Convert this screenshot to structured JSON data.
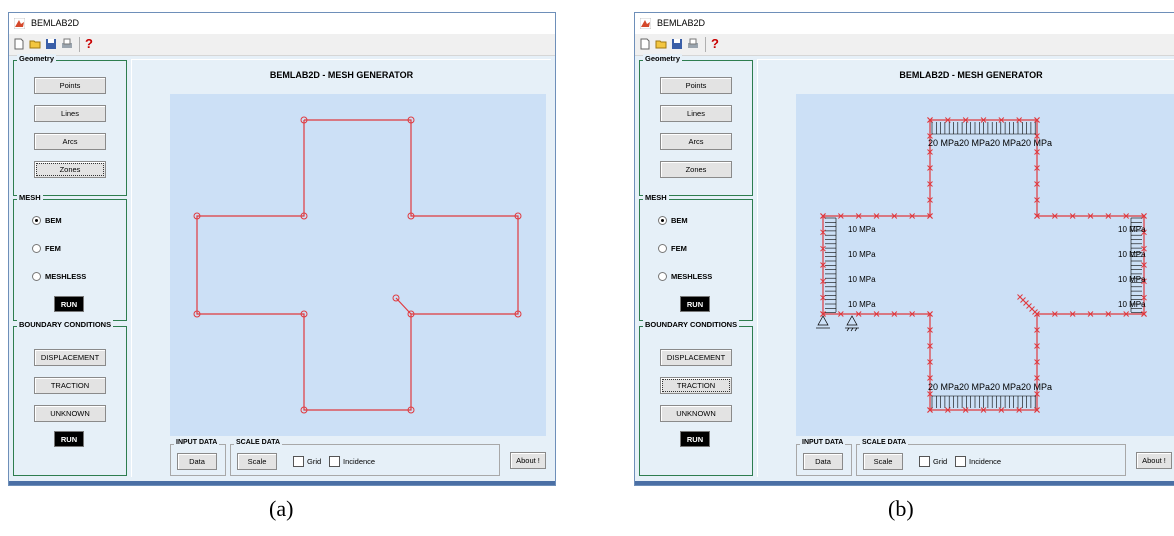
{
  "windows": [
    {
      "id": "a",
      "title": "BEMLAB2D",
      "main_title": "BEMLAB2D - MESH GENERATOR",
      "geometry": {
        "title": "Geometry",
        "buttons": [
          "Points",
          "Lines",
          "Arcs",
          "Zones"
        ],
        "focused": "Zones"
      },
      "mesh": {
        "title": "MESH",
        "options": [
          "BEM",
          "FEM",
          "MESHLESS"
        ],
        "selected": "BEM",
        "run_label": "RUN"
      },
      "boundary": {
        "title": "BOUNDARY CONDITIONS",
        "buttons": [
          "DISPLACEMENT",
          "TRACTION",
          "UNKNOWN"
        ],
        "focused": "",
        "run_label": "RUN"
      },
      "input_data": {
        "title": "INPUT DATA",
        "button": "Data"
      },
      "scale_data": {
        "title": "SCALE DATA",
        "button": "Scale",
        "grid_label": "Grid",
        "incidence_label": "Incidence"
      },
      "about_label": "About !",
      "caption": "(a)"
    },
    {
      "id": "b",
      "title": "BEMLAB2D",
      "main_title": "BEMLAB2D - MESH GENERATOR",
      "geometry": {
        "title": "Geometry",
        "buttons": [
          "Points",
          "Lines",
          "Arcs",
          "Zones"
        ],
        "focused": ""
      },
      "mesh": {
        "title": "MESH",
        "options": [
          "BEM",
          "FEM",
          "MESHLESS"
        ],
        "selected": "BEM",
        "run_label": "RUN"
      },
      "boundary": {
        "title": "BOUNDARY CONDITIONS",
        "buttons": [
          "DISPLACEMENT",
          "TRACTION",
          "UNKNOWN"
        ],
        "focused": "TRACTION",
        "run_label": "RUN"
      },
      "input_data": {
        "title": "INPUT DATA",
        "button": "Data"
      },
      "scale_data": {
        "title": "SCALE DATA",
        "button": "Scale",
        "grid_label": "Grid",
        "incidence_label": "Incidence"
      },
      "about_label": "About !",
      "caption": "(b)",
      "loads": {
        "top": "20 MPa20 MPa20 MPa20 MPa",
        "bottom": "20 MPa20 MPa20 MPa20 MPa",
        "left": [
          "10 MPa",
          "10 MPa",
          "10 MPa",
          "10 MPa"
        ],
        "right": [
          "10 MPa",
          "10 MPa",
          "10 MPa",
          "10 MPa"
        ]
      }
    }
  ],
  "colors": {
    "plot_bg": "#cce0f6",
    "panel_bg": "#e6f0f8",
    "geometry_line": "#e0393e",
    "panel_border": "#2e7d4f"
  },
  "icons": [
    "matlab-app-icon",
    "new-file-icon",
    "open-folder-icon",
    "save-icon",
    "print-icon",
    "help-icon"
  ]
}
